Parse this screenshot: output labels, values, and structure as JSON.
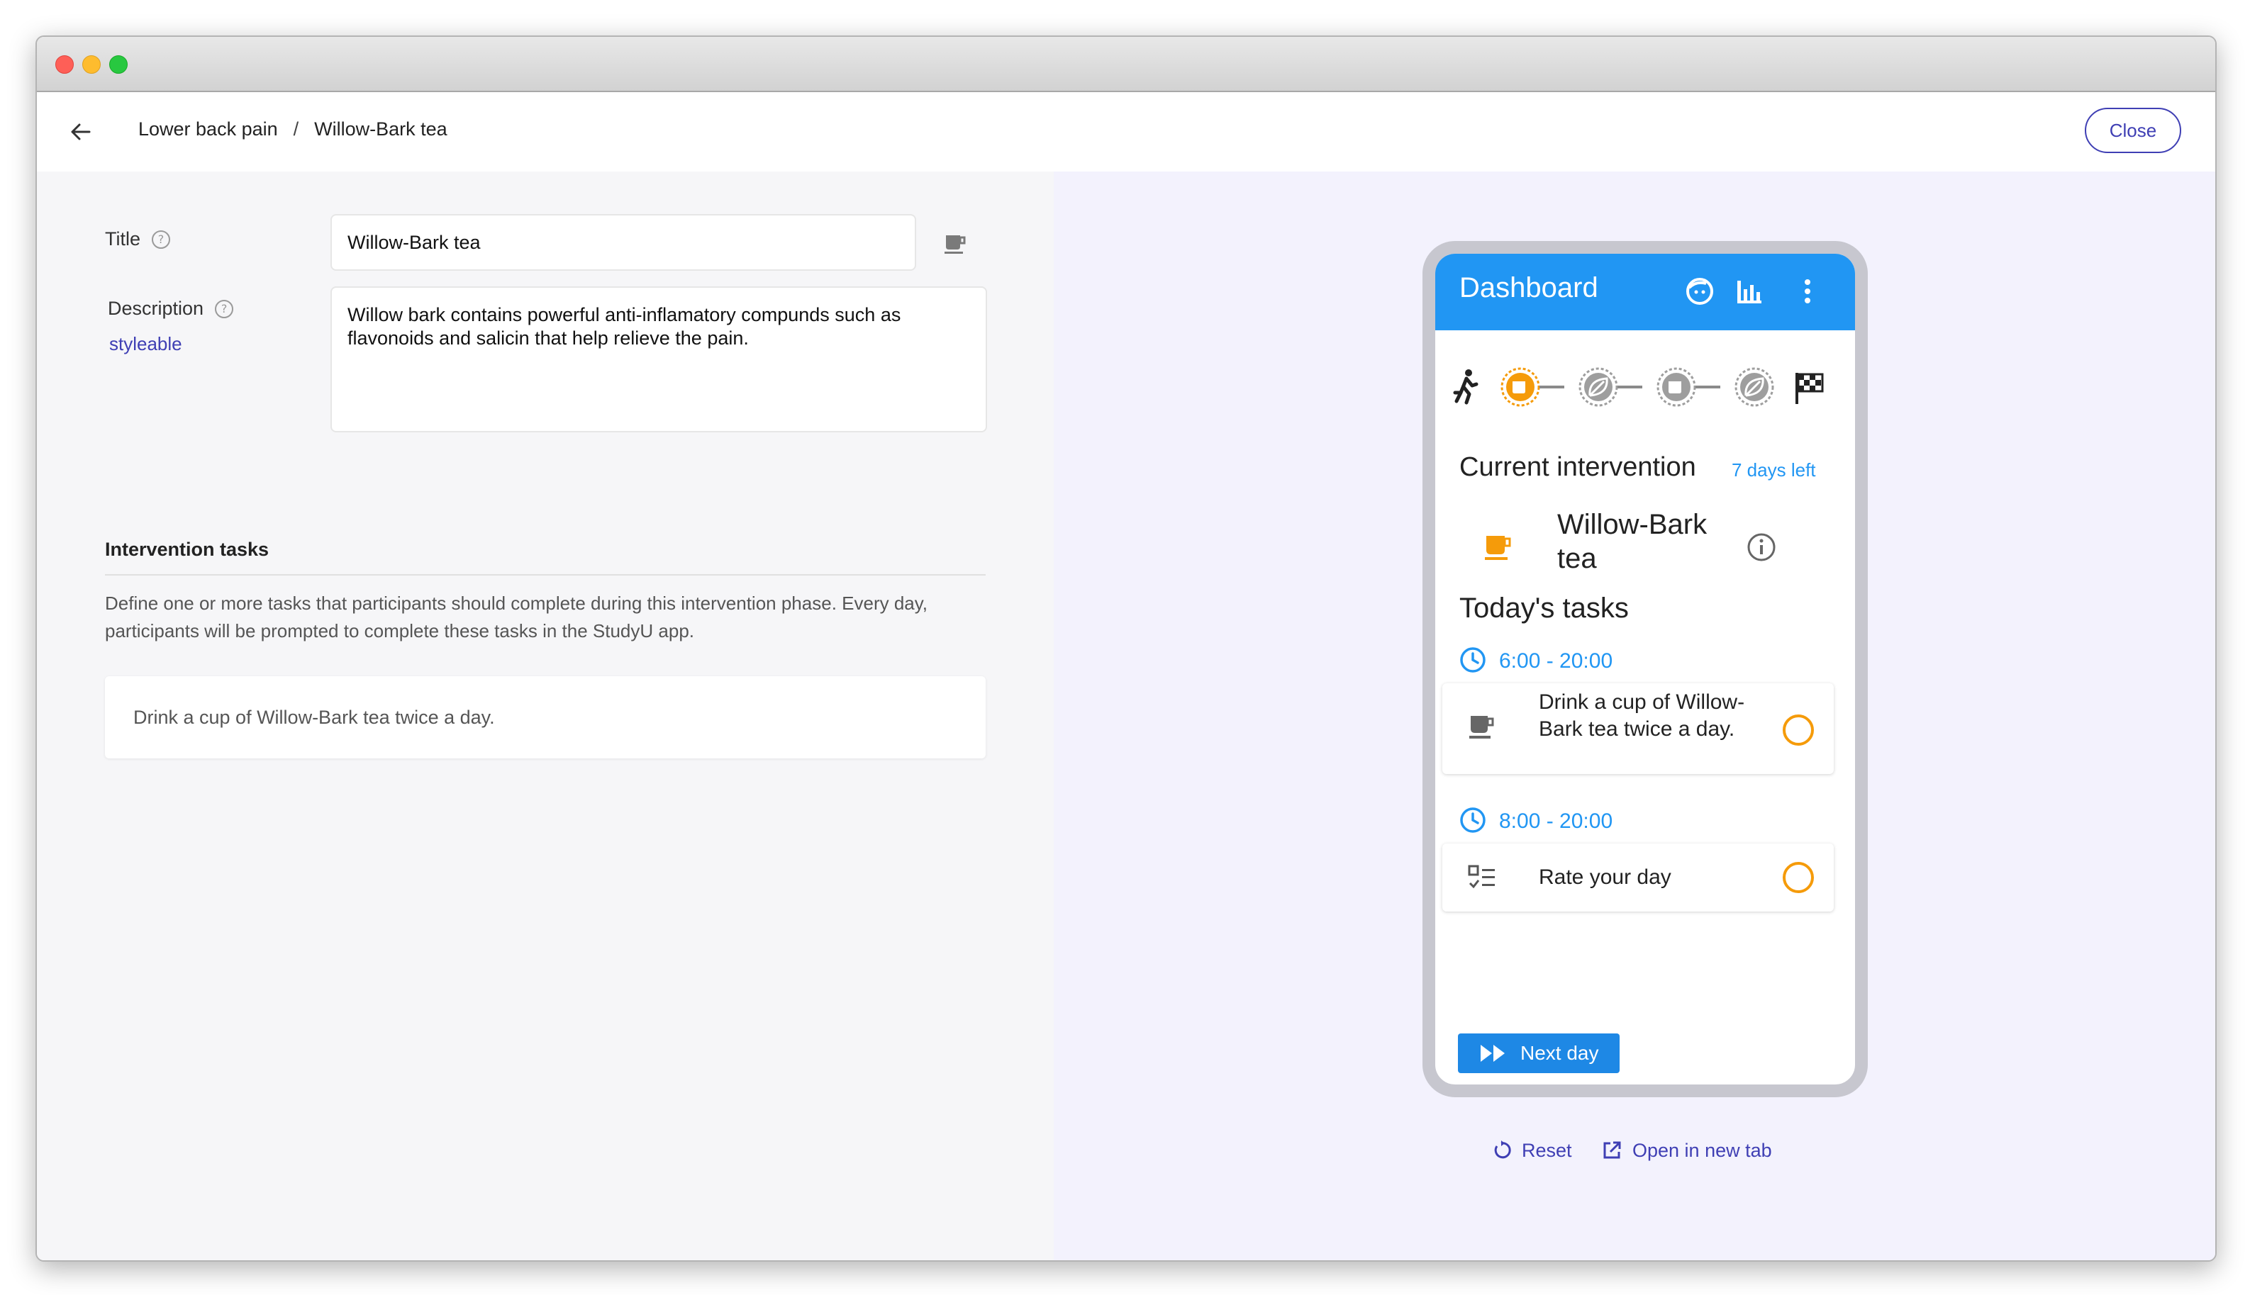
{
  "header": {
    "breadcrumb": [
      "Lower back pain",
      "Willow-Bark tea"
    ],
    "breadcrumb_separator": "/",
    "close_label": "Close"
  },
  "form": {
    "title_label": "Title",
    "title_value": "Willow-Bark tea",
    "description_label": "Description",
    "styleable_link": "styleable",
    "description_value": "Willow bark contains powerful anti-inflamatory compunds such as flavonoids and salicin that help relieve the pain.",
    "icon": "coffee-cup-icon"
  },
  "tasks_section": {
    "title": "Intervention tasks",
    "description": "Define one or more tasks that participants should complete during this intervention phase. Every day, participants will be prompted to complete these tasks in the StudyU app.",
    "tasks": [
      {
        "text": "Drink a cup of Willow-Bark tea twice a day."
      }
    ]
  },
  "preview": {
    "app_title": "Dashboard",
    "header_icons": [
      "face-icon",
      "bar-chart-icon",
      "more-vert-icon"
    ],
    "progress_icons": [
      "running-icon",
      "coffee-cup-icon",
      "leaf-icon",
      "coffee-cup-icon",
      "leaf-icon",
      "checkered-flag-icon"
    ],
    "current_intervention_label": "Current intervention",
    "days_left": "7 days left",
    "intervention_name": "Willow-Bark tea",
    "todays_tasks_label": "Today's tasks",
    "tasks": [
      {
        "time": "6:00 - 20:00",
        "text": "Drink a cup of Willow-Bark tea twice a day.",
        "icon": "coffee-cup-icon"
      },
      {
        "time": "8:00 - 20:00",
        "text": "Rate your day",
        "icon": "checklist-icon"
      }
    ],
    "next_day_label": "Next day",
    "reset_label": "Reset",
    "open_new_tab_label": "Open in new tab"
  },
  "colors": {
    "accent": "#3f3fb4",
    "app_blue": "#2196f3",
    "orange": "#f59b0a"
  }
}
